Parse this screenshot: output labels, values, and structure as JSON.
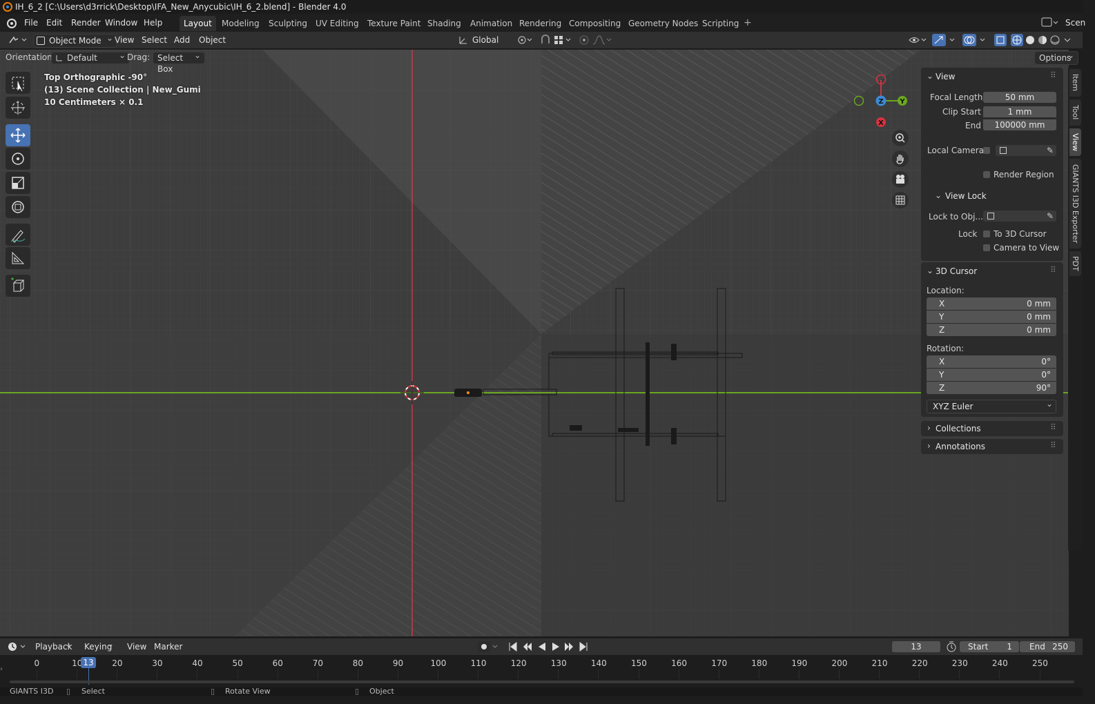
{
  "window": {
    "title": "IH_6_2 [C:\\Users\\d3rrick\\Desktop\\IFA_New_Anycubic\\IH_6_2.blend] - Blender 4.0"
  },
  "menubar": {
    "items": [
      "File",
      "Edit",
      "Render",
      "Window",
      "Help"
    ],
    "workspaces": [
      "Layout",
      "Modeling",
      "Sculpting",
      "UV Editing",
      "Texture Paint",
      "Shading",
      "Animation",
      "Rendering",
      "Compositing",
      "Geometry Nodes",
      "Scripting"
    ],
    "active_workspace": "Layout",
    "scene_label": "Scen"
  },
  "viewport_header": {
    "mode": "Object Mode",
    "menus": [
      "View",
      "Select",
      "Add",
      "Object"
    ],
    "transform_orientation": "Global"
  },
  "tool_header": {
    "orientation_label": "Orientation:",
    "orientation_value": "Default",
    "drag_label": "Drag:",
    "drag_value": "Select Box",
    "options_label": "Options"
  },
  "viewport_overlay": {
    "view_name": "Top Orthographic -90°",
    "collection": "(13) Scene Collection | New_Gumi",
    "grid_scale": "10 Centimeters × 0.1"
  },
  "gizmo": {
    "x": "X",
    "y": "Y",
    "z": "Z"
  },
  "npanel": {
    "view": {
      "header": "View",
      "focal_length_label": "Focal Length",
      "focal_length": "50 mm",
      "clip_start_label": "Clip Start",
      "clip_start": "1 mm",
      "clip_end_label": "End",
      "clip_end": "100000 mm",
      "local_camera_label": "Local Camera",
      "render_region_label": "Render Region"
    },
    "view_lock": {
      "header": "View Lock",
      "lock_to_object_label": "Lock to Obj...",
      "lock_label": "Lock",
      "to_3d_cursor": "To 3D Cursor",
      "camera_to_view": "Camera to View"
    },
    "cursor": {
      "header": "3D Cursor",
      "location_label": "Location:",
      "loc_x_label": "X",
      "loc_x": "0 mm",
      "loc_y_label": "Y",
      "loc_y": "0 mm",
      "loc_z_label": "Z",
      "loc_z": "0 mm",
      "rotation_label": "Rotation:",
      "rot_x_label": "X",
      "rot_x": "0°",
      "rot_y_label": "Y",
      "rot_y": "0°",
      "rot_z_label": "Z",
      "rot_z": "90°",
      "rotation_mode": "XYZ Euler"
    },
    "collections_header": "Collections",
    "annotations_header": "Annotations"
  },
  "side_tabs": [
    "Item",
    "Tool",
    "View",
    "GIANTS I3D Exporter",
    "PDT"
  ],
  "timeline": {
    "menus": [
      "Playback",
      "Keying",
      "View",
      "Marker"
    ],
    "current_frame": "13",
    "start_label": "Start",
    "start": "1",
    "end_label": "End",
    "end": "250",
    "ticks": [
      "0",
      "10",
      "20",
      "30",
      "40",
      "50",
      "60",
      "70",
      "80",
      "90",
      "100",
      "110",
      "120",
      "130",
      "140",
      "150",
      "160",
      "170",
      "180",
      "190",
      "200",
      "210",
      "220",
      "230",
      "240",
      "250"
    ],
    "playhead": "13"
  },
  "statusbar": {
    "left": "GIANTS I3D",
    "select": "Select",
    "rotate": "Rotate View",
    "object": "Object"
  },
  "colors": {
    "accent": "#4772b3",
    "x_axis": "#d9323f",
    "y_axis": "#6ba720",
    "z_axis": "#3a8ad6"
  }
}
